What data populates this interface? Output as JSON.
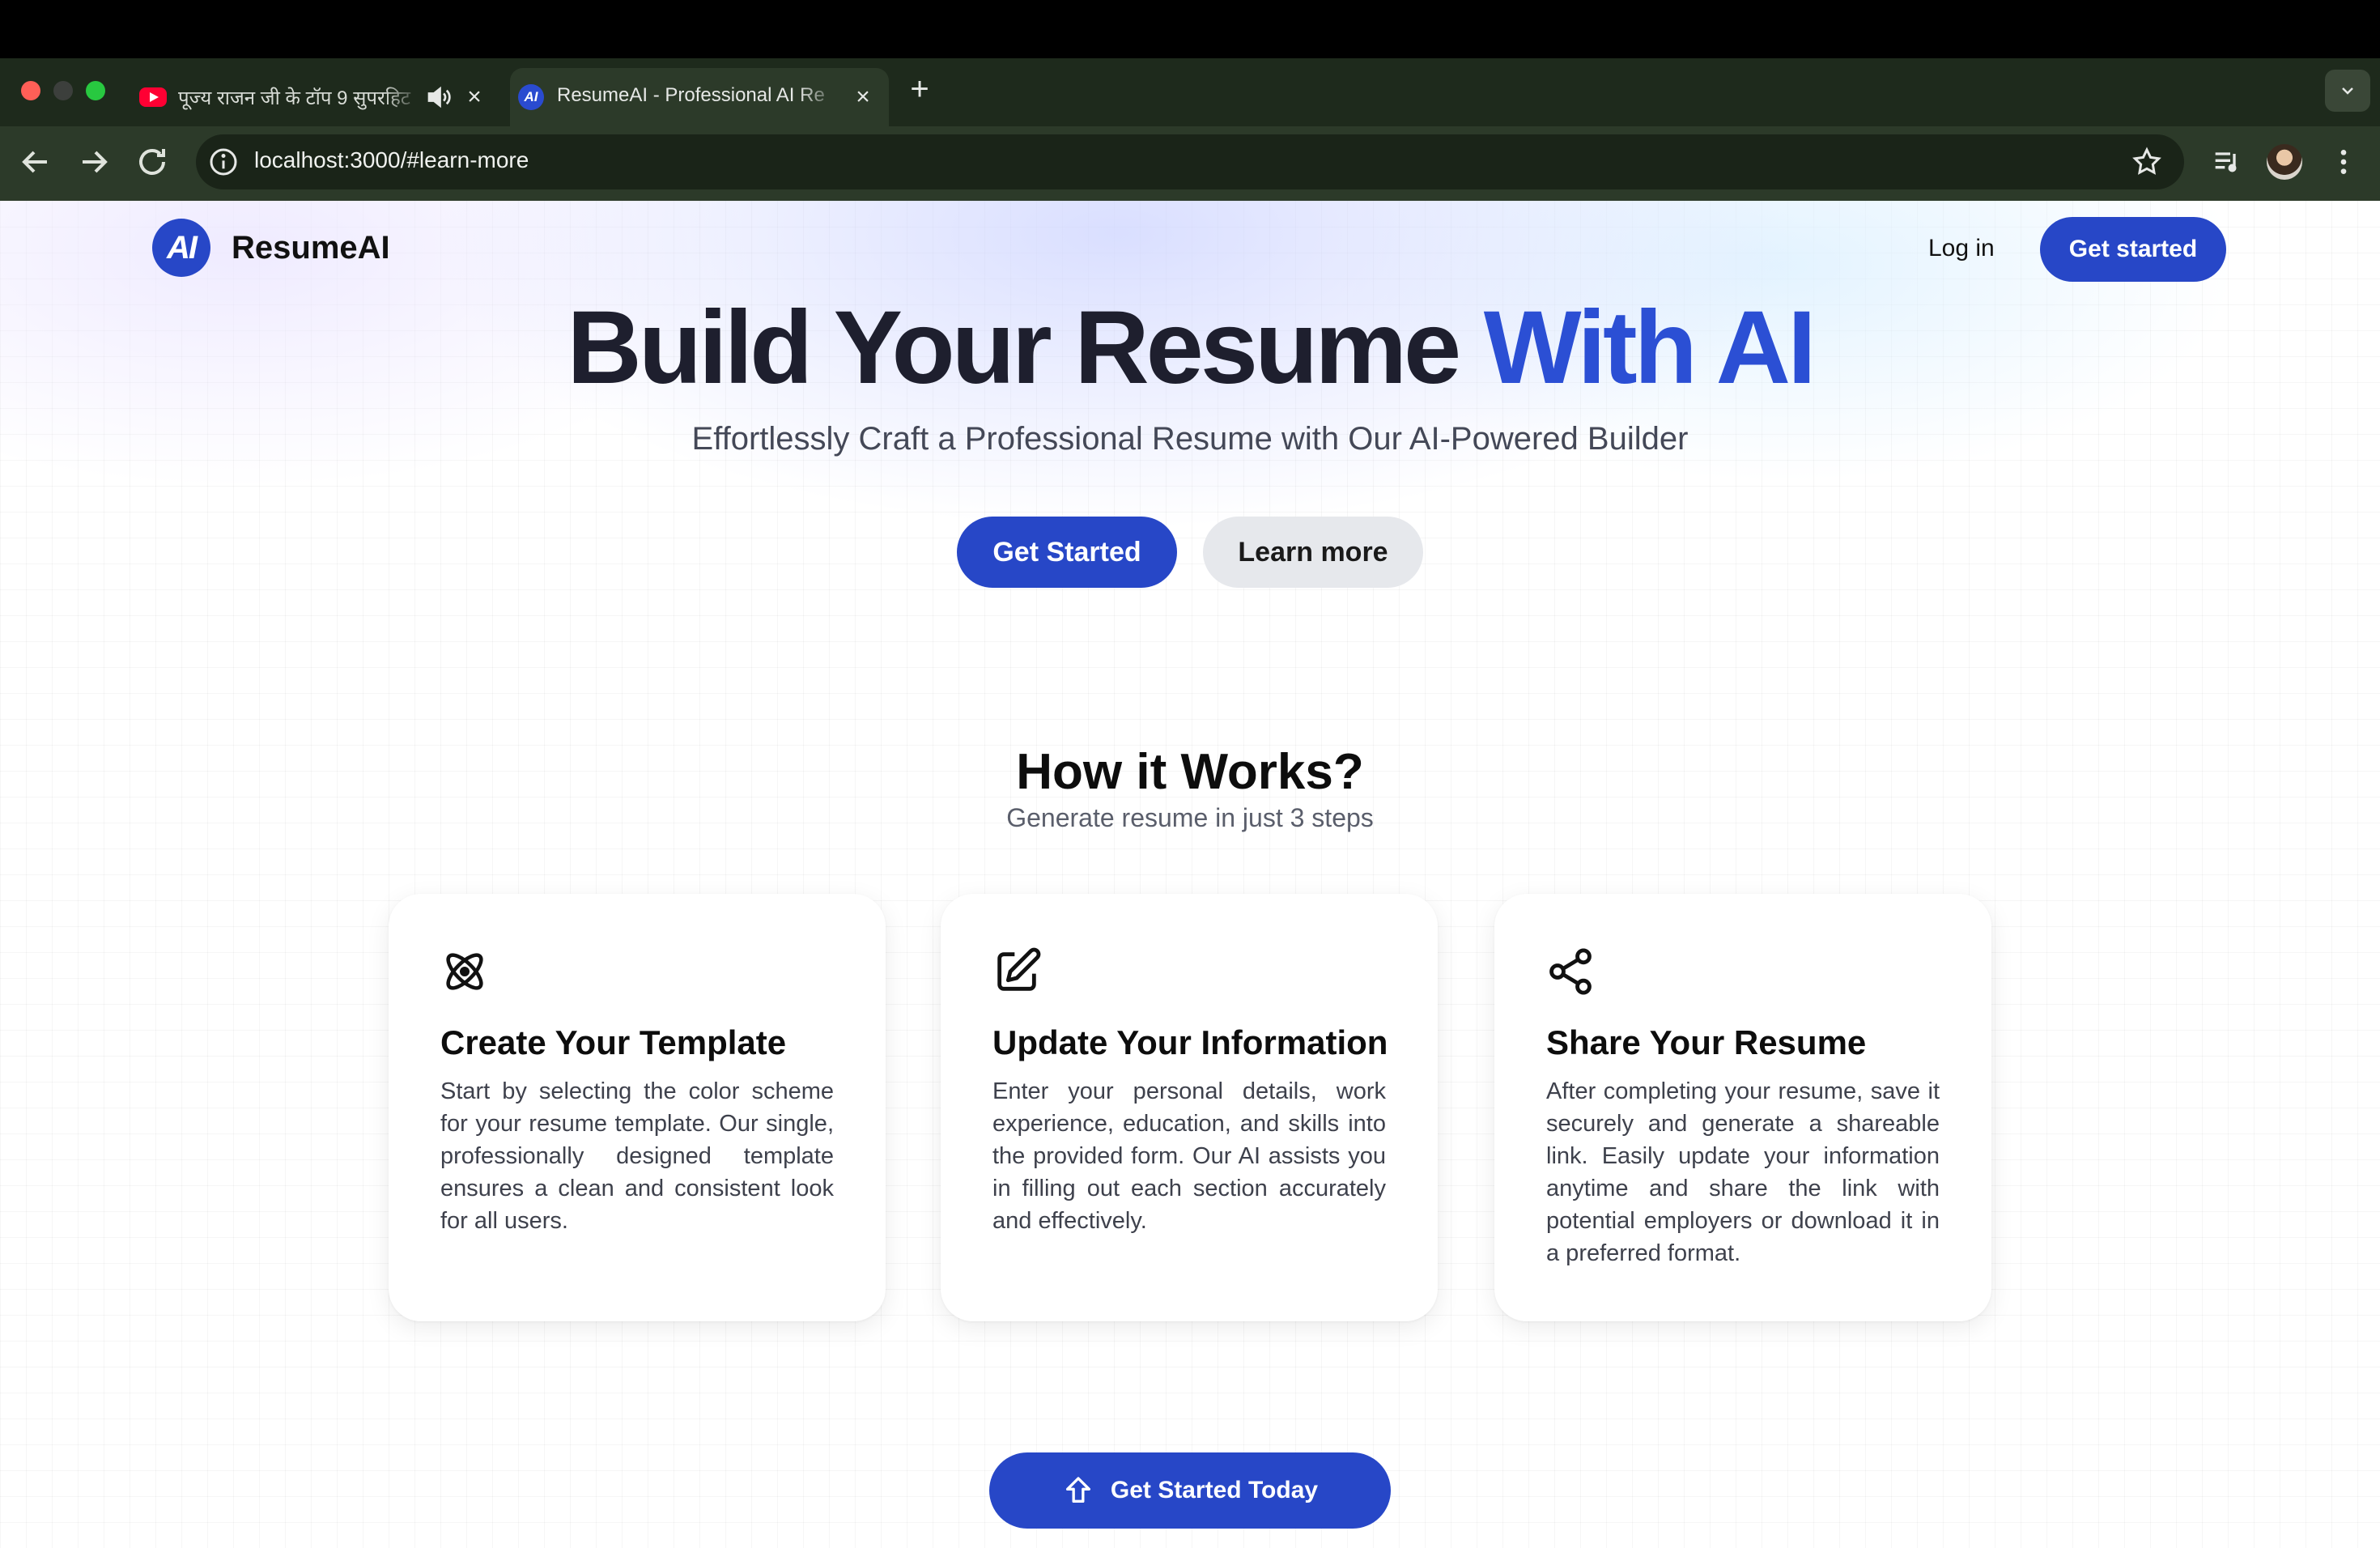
{
  "browser": {
    "tabs": [
      {
        "title": "पूज्य राजन जी के टॉप 9 सुपरहिट",
        "favicon": "youtube-icon",
        "audio": true,
        "active": false
      },
      {
        "title": "ResumeAI - Professional AI Re",
        "favicon": "resumeai-icon",
        "active": true
      }
    ],
    "favicon_text": "AI",
    "url": "localhost:3000/#learn-more"
  },
  "nav": {
    "logo_text": "AI",
    "brand": "ResumeAI",
    "login": "Log in",
    "cta": "Get started"
  },
  "hero": {
    "title_main": "Build Your Resume",
    "title_accent": "With AI",
    "subtitle": "Effortlessly Craft a Professional Resume with Our AI-Powered Builder",
    "primary_button": "Get Started",
    "secondary_button": "Learn more"
  },
  "how": {
    "title": "How it Works?",
    "subtitle": "Generate resume in just 3 steps",
    "cards": [
      {
        "icon": "atom-icon",
        "title": "Create Your Template",
        "text": "Start by selecting the color scheme for your resume template. Our single, professionally designed template ensures a clean and consistent look for all users."
      },
      {
        "icon": "edit-icon",
        "title": "Update Your Information",
        "text": "Enter your personal details, work experience, education, and skills into the provided form. Our AI assists you in filling out each section accurately and effectively."
      },
      {
        "icon": "share-icon",
        "title": "Share Your Resume",
        "text": "After completing your resume, save it securely and generate a shareable link. Easily update your information anytime and share the link with potential employers or download it in a preferred format."
      }
    ]
  },
  "bottom_cta": "Get Started Today",
  "colors": {
    "accent": "#2747c7",
    "title": "#1e1f2e",
    "chrome": "#2c3a29"
  }
}
